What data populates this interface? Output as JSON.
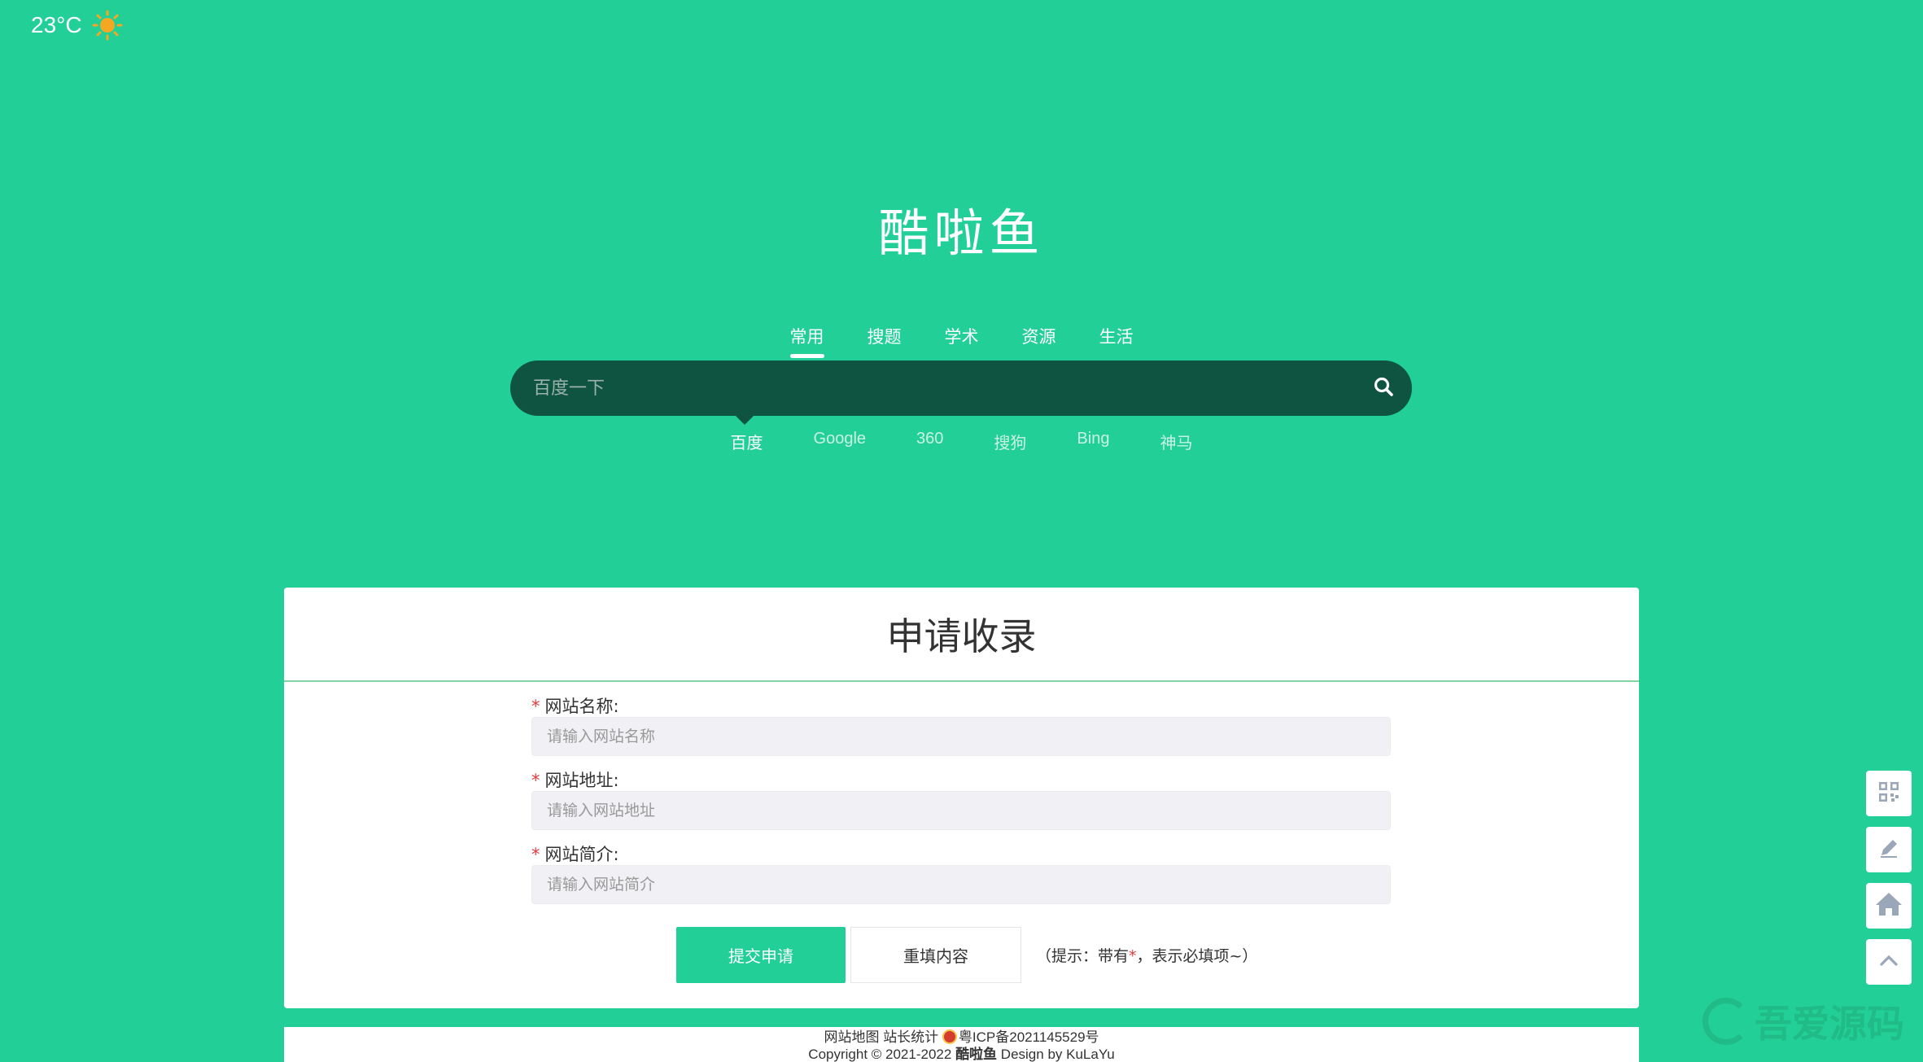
{
  "weather": {
    "temperature": "23°C",
    "icon": "sun-icon",
    "icon_color": "#f5a623"
  },
  "site": {
    "logo_text": "酷啦鱼"
  },
  "search": {
    "tabs": [
      {
        "label": "常用",
        "active": true
      },
      {
        "label": "搜题",
        "active": false
      },
      {
        "label": "学术",
        "active": false
      },
      {
        "label": "资源",
        "active": false
      },
      {
        "label": "生活",
        "active": false
      }
    ],
    "placeholder": "百度一下",
    "engines": [
      {
        "label": "百度",
        "active": true
      },
      {
        "label": "Google",
        "active": false
      },
      {
        "label": "360",
        "active": false
      },
      {
        "label": "搜狗",
        "active": false
      },
      {
        "label": "Bing",
        "active": false
      },
      {
        "label": "神马",
        "active": false
      }
    ]
  },
  "form": {
    "title": "申请收录",
    "fields": [
      {
        "required_mark": "*",
        "label": "网站名称:",
        "placeholder": "请输入网站名称",
        "value": ""
      },
      {
        "required_mark": "*",
        "label": "网站地址:",
        "placeholder": "请输入网站地址",
        "value": ""
      },
      {
        "required_mark": "*",
        "label": "网站简介:",
        "placeholder": "请输入网站简介",
        "value": ""
      }
    ],
    "submit_label": "提交申请",
    "reset_label": "重填内容",
    "hint_prefix": "（提示：带有",
    "hint_mark": "*",
    "hint_suffix": "，表示必填项~）"
  },
  "footer": {
    "sitemap": "网站地图",
    "stats": "站长统计",
    "icp": "粤ICP备2021145529号",
    "copyright_prefix": "Copyright © 2021-2022",
    "brand": "酷啦鱼",
    "design": "Design by KuLaYu"
  },
  "side_tools": [
    {
      "icon": "qrcode-icon"
    },
    {
      "icon": "edit-icon"
    },
    {
      "icon": "home-icon"
    },
    {
      "icon": "back-to-top-icon"
    }
  ],
  "watermark": {
    "text": "吾爱源码"
  },
  "colors": {
    "background": "#22cf97",
    "search_bg": "#0e5441",
    "accent": "#22cf97",
    "required": "#e4393c",
    "icon_gray": "#9aa7b8"
  }
}
